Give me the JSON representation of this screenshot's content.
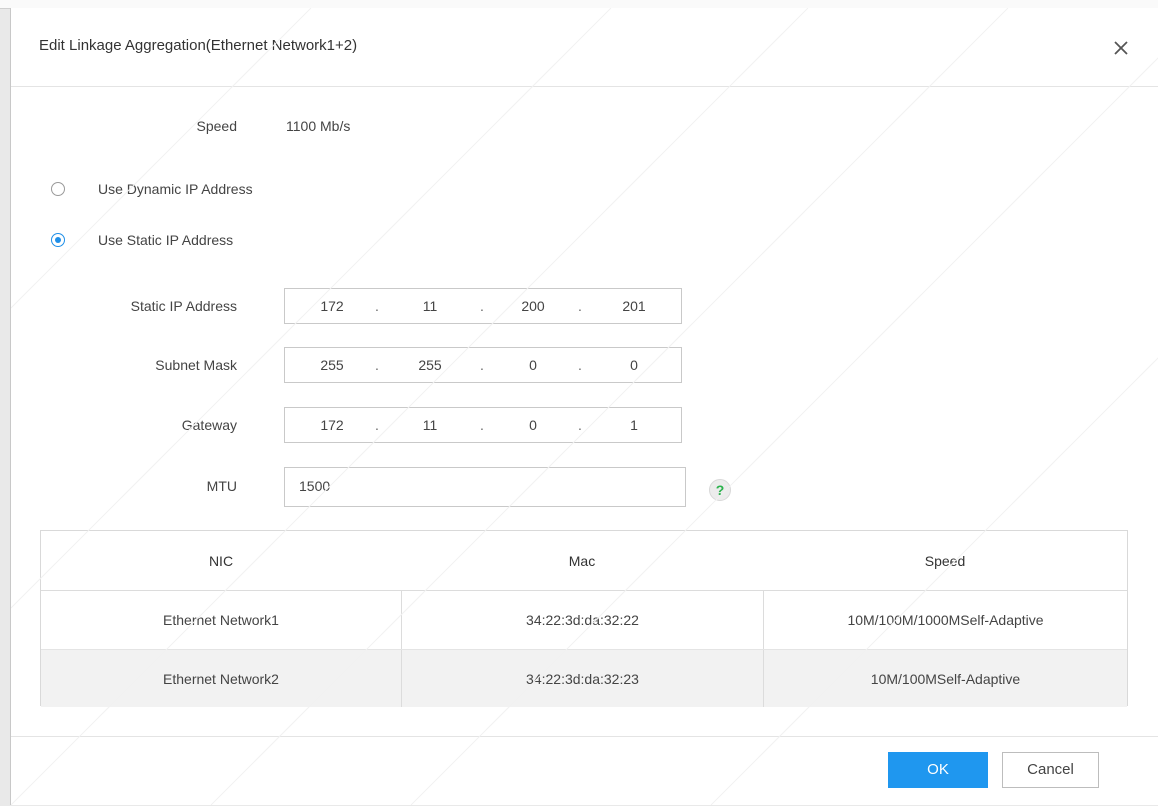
{
  "dialog": {
    "title": "Edit Linkage Aggregation(Ethernet Network1+2)"
  },
  "speed": {
    "label": "Speed",
    "value": "1100 Mb/s"
  },
  "ip_mode": {
    "dynamic_label": "Use Dynamic IP Address",
    "static_label": "Use Static IP Address",
    "selected": "static"
  },
  "fields": {
    "static_ip": {
      "label": "Static IP Address",
      "octets": [
        "172",
        "11",
        "200",
        "201"
      ]
    },
    "subnet_mask": {
      "label": "Subnet Mask",
      "octets": [
        "255",
        "255",
        "0",
        "0"
      ]
    },
    "gateway": {
      "label": "Gateway",
      "octets": [
        "172",
        "11",
        "0",
        "1"
      ]
    },
    "mtu": {
      "label": "MTU",
      "value": "1500",
      "help_icon": "question-icon"
    }
  },
  "table": {
    "headers": [
      "NIC",
      "Mac",
      "Speed"
    ],
    "rows": [
      [
        "Ethernet Network1",
        "34:22:3d:da:32:22",
        "10M/100M/1000MSelf-Adaptive"
      ],
      [
        "Ethernet Network2",
        "34:22:3d:da:32:23",
        "10M/100MSelf-Adaptive"
      ]
    ]
  },
  "footer": {
    "ok_label": "OK",
    "cancel_label": "Cancel"
  },
  "colors": {
    "accent": "#1f97ef",
    "radio": "#1f8fe8",
    "help": "#2bb24c"
  }
}
